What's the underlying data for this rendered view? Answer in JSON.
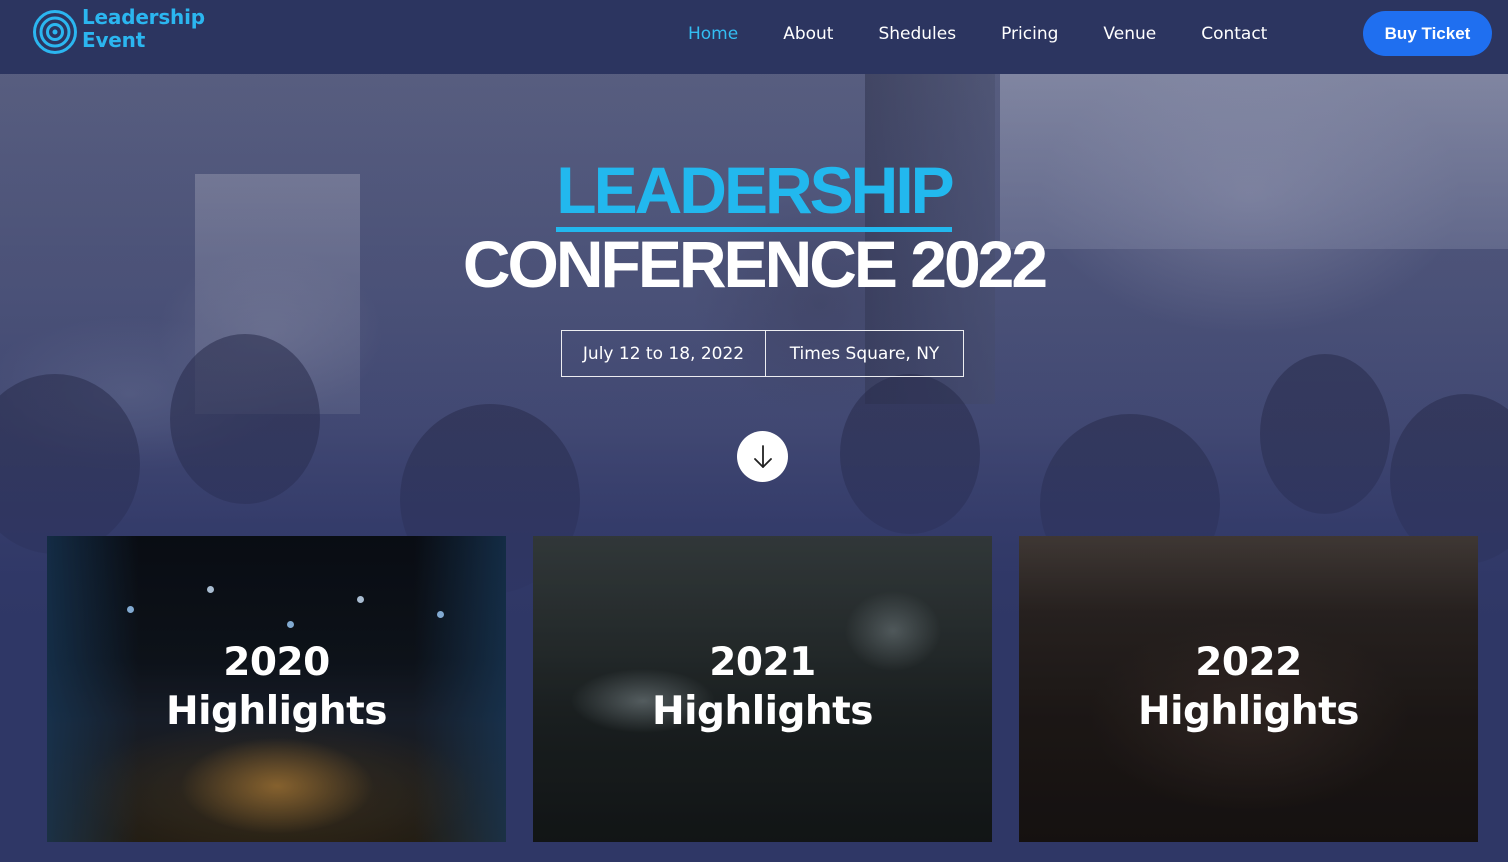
{
  "brand": {
    "line1": "Leadership",
    "line2": "Event",
    "logo_icon": "concentric-circles-icon",
    "color": "#2bb6f0"
  },
  "nav": {
    "items": [
      {
        "label": "Home",
        "active": true
      },
      {
        "label": "About",
        "active": false
      },
      {
        "label": "Shedules",
        "active": false
      },
      {
        "label": "Pricing",
        "active": false
      },
      {
        "label": "Venue",
        "active": false
      },
      {
        "label": "Contact",
        "active": false
      }
    ],
    "buy_ticket": "Buy Ticket"
  },
  "hero": {
    "title_highlight": "LEADERSHIP",
    "title_main": "CONFERENCE 2022",
    "date": "July 12 to 18, 2022",
    "location": "Times Square, NY",
    "scroll_icon": "arrow-down-icon"
  },
  "highlights": [
    {
      "year": "2020",
      "label": "Highlights"
    },
    {
      "year": "2021",
      "label": "Highlights"
    },
    {
      "year": "2022",
      "label": "Highlights"
    }
  ],
  "colors": {
    "nav_bg": "#2c3560",
    "page_bg": "#2f3766",
    "accent": "#22b8ee",
    "button": "#1f6ff0"
  }
}
